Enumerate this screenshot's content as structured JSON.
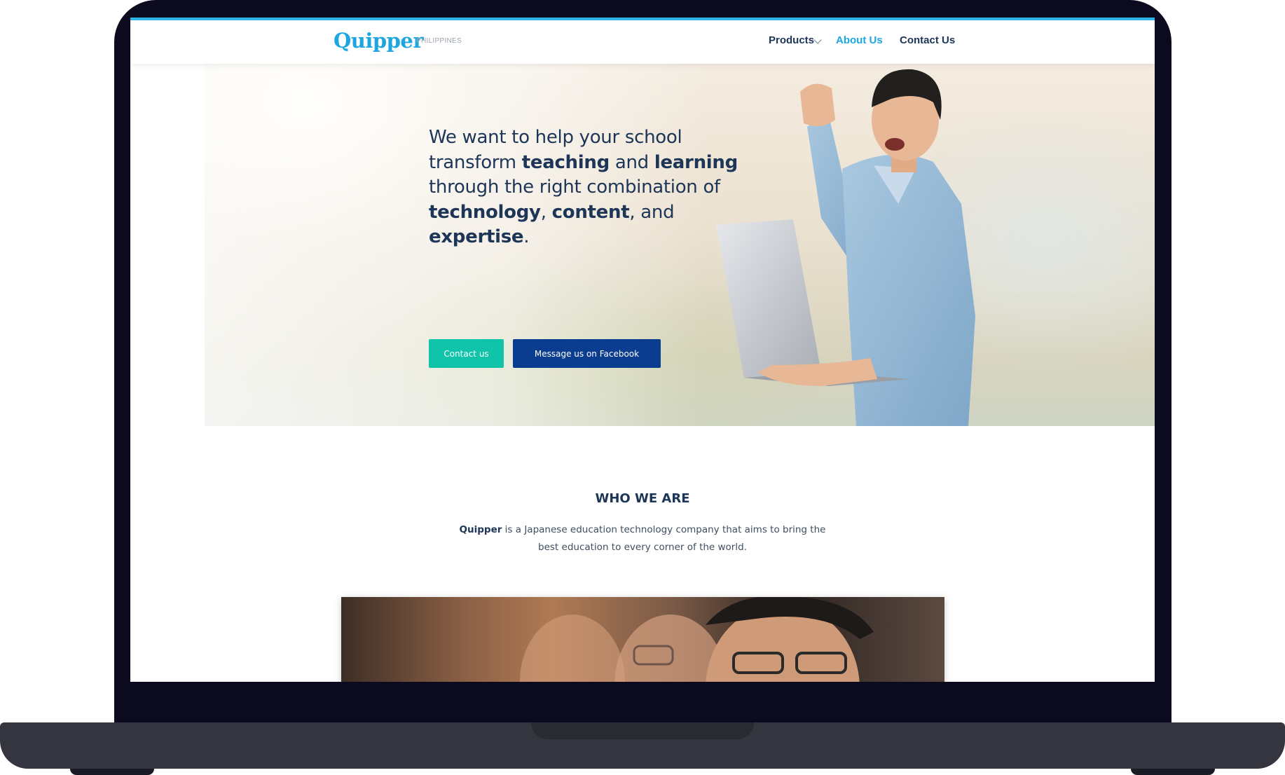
{
  "nav": {
    "logo": "Quipper",
    "logo_sub": "PHILIPPINES",
    "links": {
      "products": "Products",
      "about": "About Us",
      "contact": "Contact Us"
    },
    "active_link": "About Us"
  },
  "hero": {
    "heading_parts": {
      "p1": "We want to help your school transform ",
      "teaching": "teaching",
      "p2": " and ",
      "learning": "learning",
      "p3": " through the right combination of  ",
      "technology": "technology",
      "p4": ", ",
      "content": "content",
      "p5": ", and ",
      "expertise": "expertise",
      "p6": "."
    },
    "buttons": {
      "contact": "Contact us",
      "facebook": "Message us on Facebook"
    }
  },
  "who_we_are": {
    "title": "WHO WE ARE",
    "brand": "Quipper",
    "description": " is a Japanese education technology company that aims to bring the best education to every corner of the world."
  },
  "colors": {
    "accent": "#1ea6e0",
    "heading": "#1d3557",
    "teal_button": "#10c4a9",
    "navy_button": "#0a3c8f",
    "laptop_frame": "#0b0a1e"
  },
  "icons": {
    "products_dropdown": "chevron-down-icon"
  }
}
